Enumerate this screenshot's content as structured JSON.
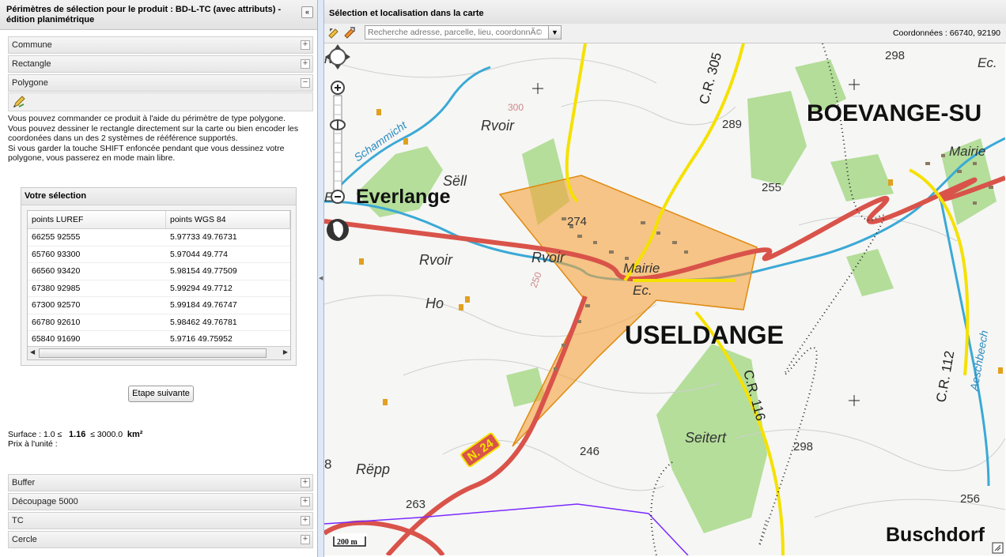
{
  "left_panel": {
    "title": "Périmètres de sélection pour le produit : BD-L-TC (avec attributs) - édition planimétrique",
    "collapse": "«",
    "sections_top": [
      {
        "label": "Commune",
        "state": "+"
      },
      {
        "label": "Rectangle",
        "state": "+"
      },
      {
        "label": "Polygone",
        "state": "−"
      }
    ],
    "description": [
      "Vous pouvez commander ce produit à l'aide du périmètre de type polygone.",
      "Vous pouvez dessiner le rectangle directement sur la carte ou bien encoder les coordonées dans un des 2 systèmes de rééférence supportés.",
      "Si vous garder la touche SHIFT enfoncée pendant que vous dessinez votre polygone, vous passerez en mode main libre."
    ],
    "selection": {
      "title": "Votre sélection",
      "headers": [
        "points LUREF",
        "points WGS 84"
      ],
      "rows": [
        [
          "66255 92555",
          "5.97733 49.76731"
        ],
        [
          "65760 93300",
          "5.97044 49.774"
        ],
        [
          "66560 93420",
          "5.98154 49.77509"
        ],
        [
          "67380 92985",
          "5.99294 49.7712"
        ],
        [
          "67300 92570",
          "5.99184 49.76747"
        ],
        [
          "66780 92610",
          "5.98462 49.76781"
        ],
        [
          "65840 91690",
          "5.9716 49.75952"
        ]
      ]
    },
    "next_button": "Etape suivante",
    "surface": {
      "label": "Surface : 1.0 ≤",
      "value": "1.16",
      "max": "≤ 3000.0",
      "unit": "km²"
    },
    "price_label": "Prix à l'unité :",
    "sections_bottom": [
      {
        "label": "Buffer",
        "state": "+"
      },
      {
        "label": "Découpage 5000",
        "state": "+"
      },
      {
        "label": "TC",
        "state": "+"
      },
      {
        "label": "Cercle",
        "state": "+"
      }
    ]
  },
  "map_panel": {
    "title": "Sélection et localisation dans la carte",
    "search_placeholder": "Recherche adresse, parcelle, lieu, coordonnÃ©",
    "coordinates": "Coordonnées : 66740, 92190",
    "scale": "200 m",
    "labels": {
      "everlange": "Everlange",
      "boevange": "BOEVANGE-SU",
      "useldange": "USELDANGE",
      "buschdorf": "Buschdorf",
      "n24": "N. 24",
      "cr305": "C.R. 305",
      "cr116": "C.R. 116",
      "cr112": "C.R. 112",
      "rvoir1": "Rvoir",
      "rvoir2": "Rvoir",
      "rvoir3": "Rvoir",
      "sell": "Sëll",
      "ho": "Ho",
      "repp": "Rëpp",
      "seitert": "Seitert",
      "mairie1": "Mairie",
      "mairie2": "Mairie",
      "ec1": "Ec.",
      "ec2": "Ec.",
      "schammicht": "Schammicht",
      "aeschbeech": "Aeschbeech",
      "h298a": "298",
      "h298b": "298",
      "h289": "289",
      "h255": "255",
      "h274": "274",
      "h300": "300",
      "h250": "250",
      "h246": "246",
      "h263": "263",
      "h256": "256",
      "edge_rt": "rt",
      "edge_ec": "Ec",
      "edge_8": "8"
    }
  },
  "colors": {
    "road_main": "#d9534a",
    "road_secondary": "#f5e100",
    "water": "#3aa9d6",
    "forest": "#9fd27a",
    "selection_fill": "#f5a33c",
    "selection_stroke": "#e08a10",
    "header_border": "#99bbe8"
  }
}
